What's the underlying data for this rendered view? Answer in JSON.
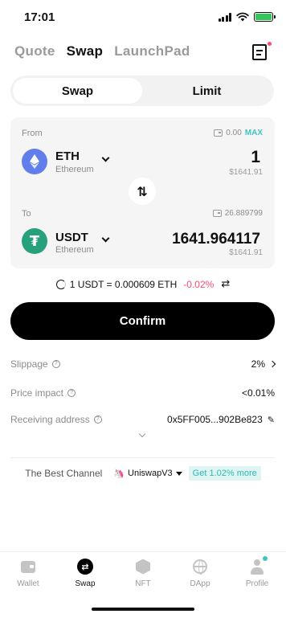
{
  "status_bar": {
    "time": "17:01"
  },
  "top_tabs": [
    {
      "label": "Quote",
      "active": false
    },
    {
      "label": "Swap",
      "active": true
    },
    {
      "label": "LaunchPad",
      "active": false
    }
  ],
  "segment": {
    "swap_label": "Swap",
    "limit_label": "Limit",
    "selected": "Swap"
  },
  "from": {
    "label": "From",
    "balance": "0.00",
    "max_label": "MAX",
    "token_symbol": "ETH",
    "token_network": "Ethereum",
    "amount": "1",
    "usd_value": "$1641.91"
  },
  "to": {
    "label": "To",
    "balance": "26.889799",
    "token_symbol": "USDT",
    "token_network": "Ethereum",
    "token_glyph": "₮",
    "amount": "1641.964117",
    "usd_value": "$1641.91"
  },
  "switch_glyph": "⇅",
  "rate": {
    "text": "1 USDT = 0.000609 ETH",
    "change": "-0.02%",
    "swap_glyph": "⇄"
  },
  "confirm_label": "Confirm",
  "details": {
    "slippage_label": "Slippage",
    "slippage_value": "2%",
    "price_impact_label": "Price impact",
    "price_impact_value": "<0.01%",
    "receiving_label": "Receiving address",
    "receiving_value": "0x5FF005...902Be823",
    "info_glyph": "?",
    "edit_glyph": "✎"
  },
  "channel": {
    "label": "The Best Channel",
    "name": "UniswapV3",
    "uni_glyph": "🦄",
    "badge": "Get 1.02% more"
  },
  "bottom_nav": [
    {
      "label": "Wallet",
      "icon": "wallet-icon",
      "active": false
    },
    {
      "label": "Swap",
      "icon": "swap-icon",
      "active": true,
      "glyph": "⇄"
    },
    {
      "label": "NFT",
      "icon": "nft-icon",
      "active": false
    },
    {
      "label": "DApp",
      "icon": "dapp-icon",
      "active": false
    },
    {
      "label": "Profile",
      "icon": "profile-icon",
      "active": false
    }
  ],
  "colors": {
    "accent": "#3fc6c1",
    "negative": "#ff4b6e",
    "eth": "#627eea",
    "usdt": "#26a17b"
  }
}
